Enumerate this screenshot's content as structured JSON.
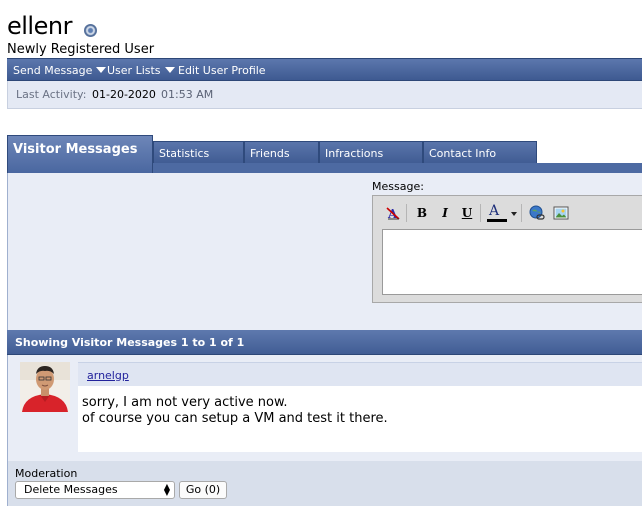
{
  "profile": {
    "username": "ellenr",
    "user_title": "Newly Registered User"
  },
  "nav": {
    "send_message": "Send Message",
    "user_lists": "User Lists",
    "edit_profile": "Edit User Profile"
  },
  "activity": {
    "label": "Last Activity:",
    "date": "01-20-2020",
    "time": "01:53 AM"
  },
  "tabs": [
    {
      "label": "Visitor Messages",
      "active": true
    },
    {
      "label": "Statistics"
    },
    {
      "label": "Friends"
    },
    {
      "label": "Infractions"
    },
    {
      "label": "Contact Info"
    }
  ],
  "editor": {
    "label": "Message:",
    "toolbar": [
      "remove-format-icon",
      "bold-icon",
      "italic-icon",
      "underline-icon",
      "font-color-icon",
      "insert-link-icon",
      "insert-image-icon"
    ],
    "bold": "B",
    "italic": "I",
    "underline": "U",
    "font_color": "A",
    "message_value": ""
  },
  "messages": {
    "header": "Showing Visitor Messages 1 to 1 of 1",
    "items": [
      {
        "author": "arnelgp",
        "lines": [
          "sorry, I am not very active now.",
          "of course you can setup a VM and test it there."
        ]
      }
    ]
  },
  "moderation": {
    "label": "Moderation",
    "selected_action": "Delete Messages",
    "go_label": "Go (0)"
  },
  "colors": {
    "nav_blue": "#4a66a0",
    "panel_bg": "#e9edf6",
    "link": "#22229c"
  }
}
